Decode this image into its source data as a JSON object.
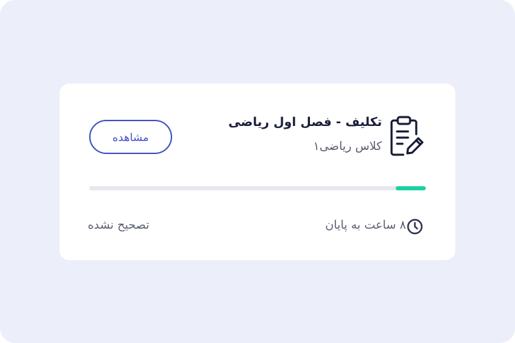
{
  "assignment": {
    "title": "تکلیف  -  فصل اول ریاضی",
    "class_name": "کلاس ریاضی۱",
    "icon": "clipboard-edit-icon",
    "view_label": "مشاهده",
    "progress_fraction": 0.09,
    "time_left": "۸ ساعت به پایان",
    "status": "تصحیح نشده"
  },
  "colors": {
    "background": "#eceff9",
    "accent": "#4352c2",
    "progress": "#19d1a5",
    "progress_track": "#e7e8ee",
    "title": "#1b1f3b",
    "muted_text": "#5a5e73"
  }
}
